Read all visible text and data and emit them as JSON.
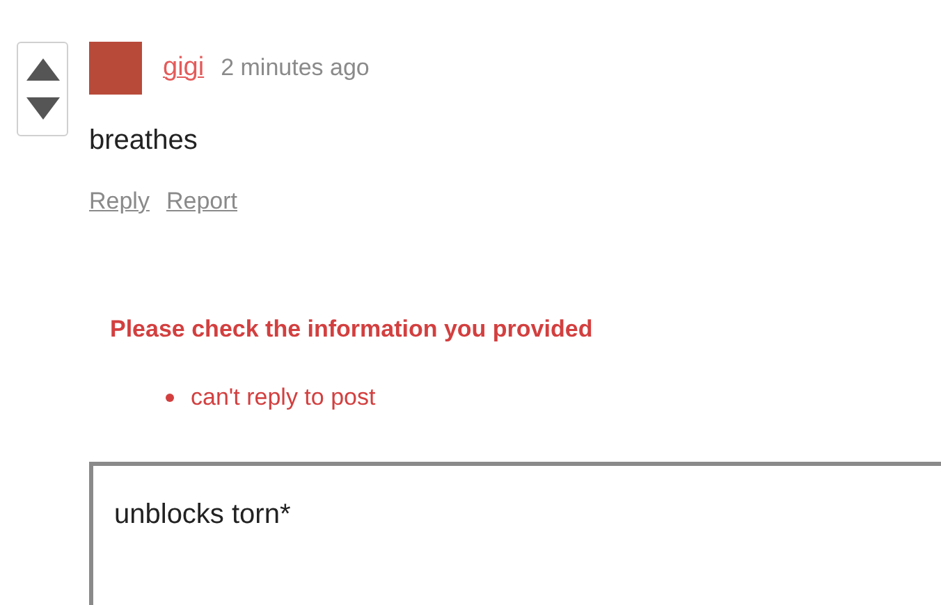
{
  "comment": {
    "author": "gigi",
    "time": "2 minutes ago",
    "body": "breathes",
    "actions": [
      "Reply",
      "Report"
    ]
  },
  "error": {
    "title": "Please check the information you provided",
    "items": [
      "can't reply to post"
    ]
  },
  "reply_field": {
    "value": "unblocks torn*"
  }
}
